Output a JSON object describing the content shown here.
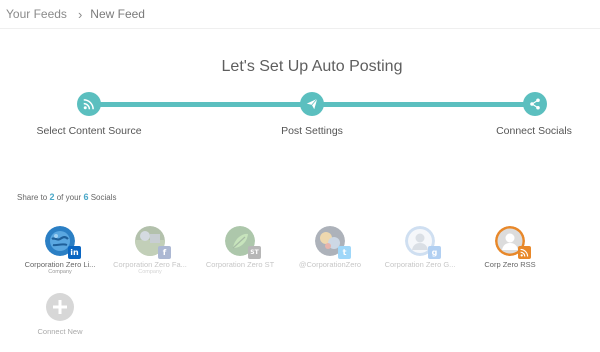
{
  "breadcrumb": {
    "root": "Your Feeds",
    "separator": "›",
    "current": "New Feed"
  },
  "page": {
    "title": "Let's Set Up Auto Posting"
  },
  "stepper": {
    "accent_color": "#5bbfbf",
    "steps": [
      {
        "label": "Select Content Source",
        "icon": "rss-icon"
      },
      {
        "label": "Post Settings",
        "icon": "paper-plane-icon"
      },
      {
        "label": "Connect Socials",
        "icon": "share-icon"
      }
    ]
  },
  "share": {
    "prefix": "Share to",
    "selected": "2",
    "middle": "of your",
    "total": "6",
    "suffix": "Socials"
  },
  "socials": [
    {
      "name": "Corporation Zero Li...",
      "sub": "Company",
      "network": "LinkedIn",
      "badge": "in",
      "badge_color": "#0a66c2",
      "active": true
    },
    {
      "name": "Corporation Zero Fa...",
      "sub": "Company",
      "network": "Facebook",
      "badge": "f",
      "badge_color": "#3b5998",
      "active": false
    },
    {
      "name": "Corporation Zero ST",
      "sub": "",
      "network": "ST",
      "badge": "ST",
      "badge_color": "#555555",
      "active": false
    },
    {
      "name": "@CorporationZero",
      "sub": "",
      "network": "Twitter",
      "badge": "t",
      "badge_color": "#1da1f2",
      "active": false
    },
    {
      "name": "Corporation Zero G...",
      "sub": "",
      "network": "Google Business",
      "badge": "g",
      "badge_color": "#4a90e2",
      "active": false
    },
    {
      "name": "Corp Zero RSS",
      "sub": "",
      "network": "RSS",
      "badge": "rss",
      "badge_color": "#e8882a",
      "active": true
    }
  ],
  "connect_new": {
    "label": "Connect New"
  }
}
